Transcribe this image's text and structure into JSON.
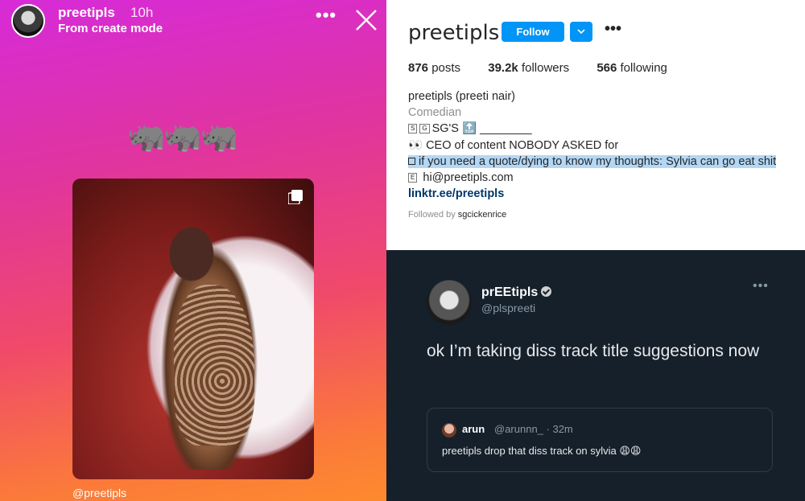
{
  "story": {
    "username": "preetipls",
    "time": "10h",
    "mode": "From create mode",
    "emoji": "🦏🦏🦏",
    "mention": "@preetipls"
  },
  "profile": {
    "username": "preetipls",
    "follow_label": "Follow",
    "stats": {
      "posts": "876",
      "posts_label": "posts",
      "followers": "39.2k",
      "followers_label": "followers",
      "following": "566",
      "following_label": "following"
    },
    "bio": {
      "full_name": "preetipls (preeti nair)",
      "category": "Comedian",
      "line1": "SG'S 🔝 ________",
      "line2": "👀 CEO of content NOBODY ASKED for",
      "line3": "if you need a quote/dying to know my thoughts: Sylvia can go eat shit",
      "line4": "hi@preetipls.com",
      "link": "linktr.ee/preetipls"
    },
    "followed_by_prefix": "Followed by",
    "followed_by": "sgcickenrice"
  },
  "tweet": {
    "name": "prEEtipls",
    "handle": "@plspreeti",
    "text": "ok I’m taking diss track title suggestions now",
    "quote": {
      "name": "arun",
      "handle": "@arunnn_ · 32m",
      "text": "preetipls drop that diss track on sylvia 😩😩"
    }
  },
  "colors": {
    "follow_blue": "#0095f6",
    "tweet_bg": "#15202b",
    "highlight": "#b3d7f5"
  }
}
